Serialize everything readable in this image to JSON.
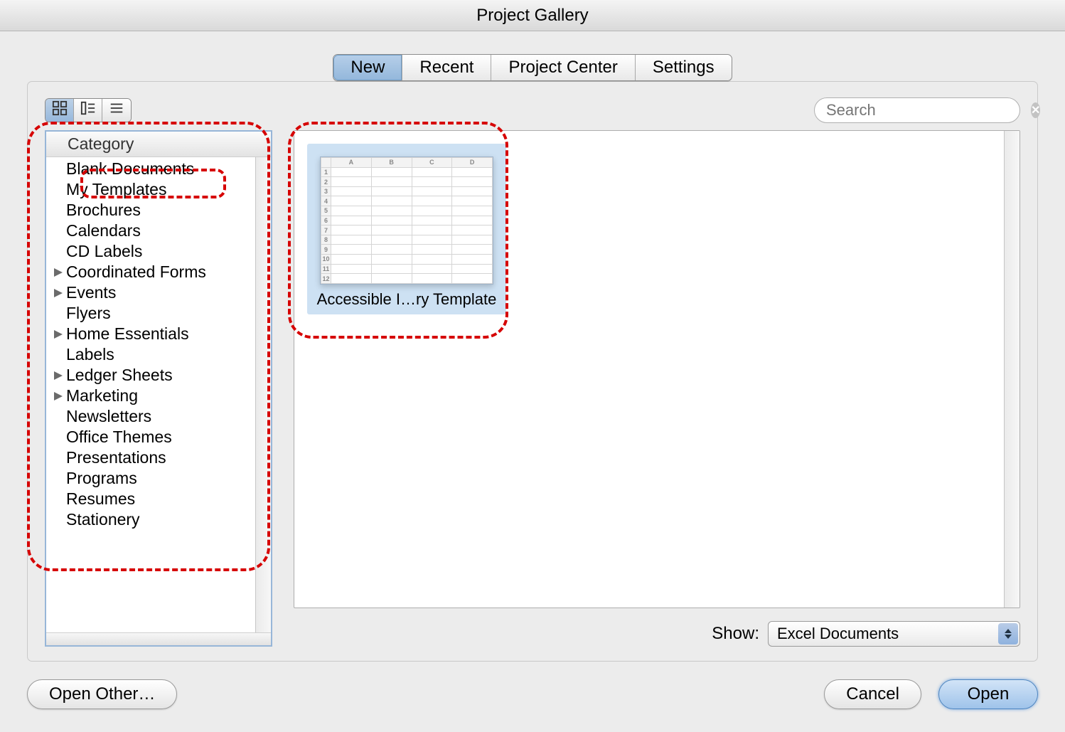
{
  "window": {
    "title": "Project Gallery"
  },
  "tabs": [
    {
      "label": "New",
      "selected": true
    },
    {
      "label": "Recent",
      "selected": false
    },
    {
      "label": "Project Center",
      "selected": false
    },
    {
      "label": "Settings",
      "selected": false
    }
  ],
  "search": {
    "placeholder": "Search"
  },
  "sidebar": {
    "header": "Category",
    "items": [
      {
        "label": "Blank Documents",
        "hasChildren": false
      },
      {
        "label": "My Templates",
        "hasChildren": false,
        "selected": true
      },
      {
        "label": "Brochures",
        "hasChildren": false
      },
      {
        "label": "Calendars",
        "hasChildren": false
      },
      {
        "label": "CD Labels",
        "hasChildren": false
      },
      {
        "label": "Coordinated Forms",
        "hasChildren": true
      },
      {
        "label": "Events",
        "hasChildren": true
      },
      {
        "label": "Flyers",
        "hasChildren": false
      },
      {
        "label": "Home Essentials",
        "hasChildren": true
      },
      {
        "label": "Labels",
        "hasChildren": false
      },
      {
        "label": "Ledger Sheets",
        "hasChildren": true
      },
      {
        "label": "Marketing",
        "hasChildren": true
      },
      {
        "label": "Newsletters",
        "hasChildren": false
      },
      {
        "label": "Office Themes",
        "hasChildren": false
      },
      {
        "label": "Presentations",
        "hasChildren": false
      },
      {
        "label": "Programs",
        "hasChildren": false
      },
      {
        "label": "Resumes",
        "hasChildren": false
      },
      {
        "label": "Stationery",
        "hasChildren": false
      }
    ]
  },
  "templates": [
    {
      "label": "Accessible I…ry Template",
      "selected": true
    }
  ],
  "show": {
    "label": "Show:",
    "value": "Excel Documents"
  },
  "buttons": {
    "open_other": "Open Other…",
    "cancel": "Cancel",
    "open": "Open"
  }
}
